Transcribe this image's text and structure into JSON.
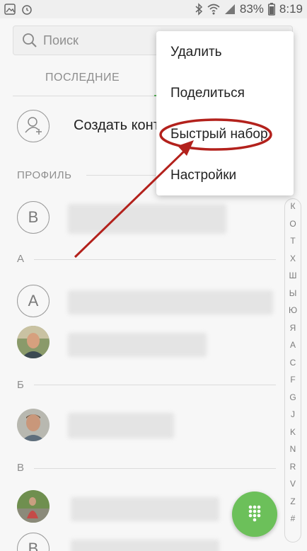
{
  "status_bar": {
    "battery_percent": "83%",
    "time": "8:19"
  },
  "search": {
    "placeholder": "Поиск"
  },
  "tabs": {
    "recent": "ПОСЛЕДНИЕ"
  },
  "create_contact": {
    "label": "Создать конт"
  },
  "sections": {
    "profile": "ПРОФИЛЬ",
    "a": "А",
    "b": "Б",
    "v": "В"
  },
  "avatars": {
    "profile_letter": "В",
    "a_letter": "А"
  },
  "index_letters": [
    "К",
    "О",
    "Т",
    "Х",
    "Ш",
    "Ы",
    "Ю",
    "Я",
    "A",
    "C",
    "F",
    "G",
    "J",
    "K",
    "N",
    "R",
    "V",
    "Z",
    "#"
  ],
  "menu": {
    "items": [
      "Удалить",
      "Поделиться",
      "Быстрый набор",
      "Настройки"
    ]
  },
  "colors": {
    "accent_green": "#59b65a",
    "fab_green": "#6cc05a",
    "annotation_red": "#b3211c"
  }
}
